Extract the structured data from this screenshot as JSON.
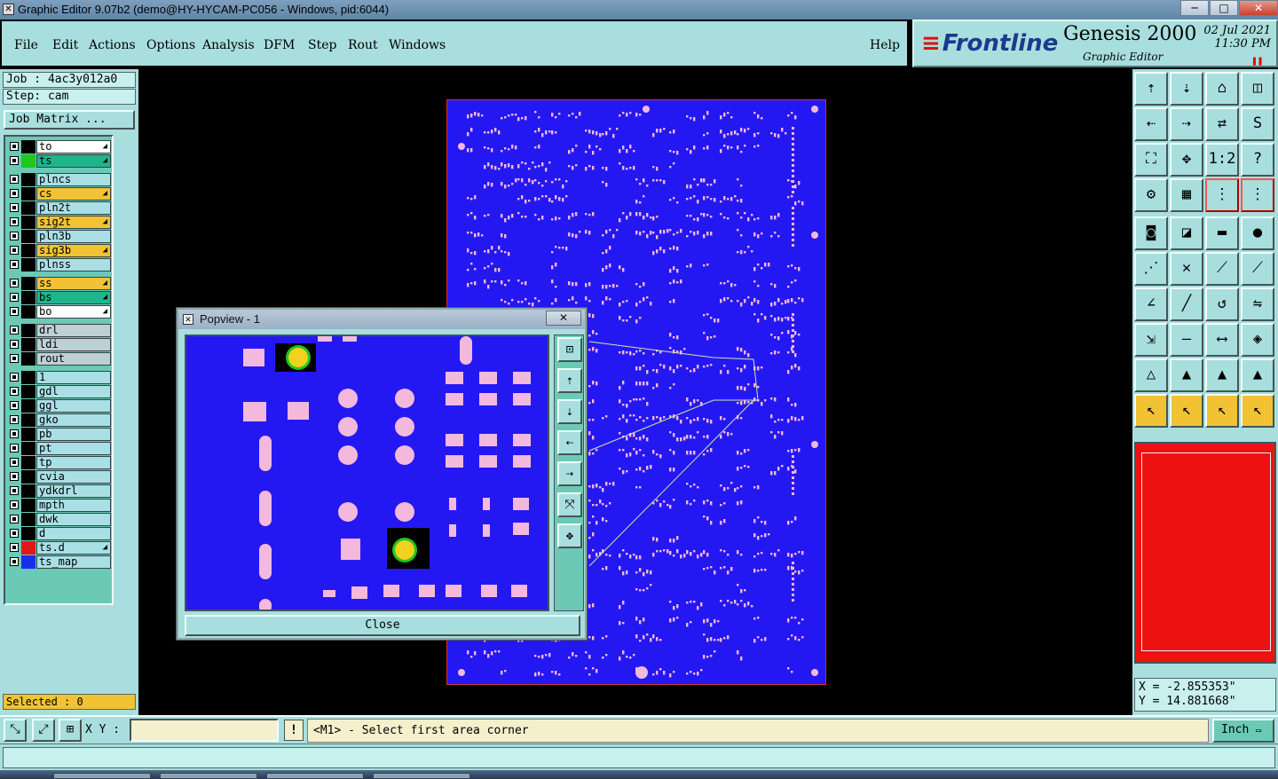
{
  "window": {
    "title": "Graphic Editor 9.07b2 (demo@HY-HYCAM-PC056 - Windows, pid:6044)",
    "buttons": {
      "minimize": "─",
      "maximize": "□",
      "close": "✕"
    }
  },
  "menu": {
    "items": [
      "File",
      "Edit",
      "Actions",
      "Options",
      "Analysis",
      "DFM",
      "Step",
      "Rout",
      "Windows"
    ],
    "help": "Help"
  },
  "brand": {
    "logo": "Frontline",
    "product": "Genesis 2000",
    "subtitle": "Graphic Editor",
    "date": "02 Jul 2021",
    "time": "11:30 PM"
  },
  "job": {
    "job_label": "Job : 4ac3y012a0",
    "step_label": "Step: cam",
    "matrix_button": "Job Matrix ..."
  },
  "layers": [
    {
      "name": "to",
      "color": "#000000",
      "bg": "#ffffff",
      "arrow": "◢"
    },
    {
      "name": "ts",
      "color": "#1ec81e",
      "bg": "#1fb58c",
      "arrow": "◢"
    },
    {
      "name": "plncs",
      "color": "#000000",
      "bg": "#aadfe6",
      "arrow": ""
    },
    {
      "name": "cs",
      "color": "#000000",
      "bg": "#f1c233",
      "arrow": "◢"
    },
    {
      "name": "pln2t",
      "color": "#000000",
      "bg": "#aadfe6",
      "arrow": ""
    },
    {
      "name": "sig2t",
      "color": "#000000",
      "bg": "#f1c233",
      "arrow": "◢"
    },
    {
      "name": "pln3b",
      "color": "#000000",
      "bg": "#aadfe6",
      "arrow": ""
    },
    {
      "name": "sig3b",
      "color": "#000000",
      "bg": "#f1c233",
      "arrow": "◢"
    },
    {
      "name": "plnss",
      "color": "#000000",
      "bg": "#aadfe6",
      "arrow": ""
    },
    {
      "name": "ss",
      "color": "#000000",
      "bg": "#f1c233",
      "arrow": "◢"
    },
    {
      "name": "bs",
      "color": "#000000",
      "bg": "#1fb58c",
      "arrow": "◢"
    },
    {
      "name": "bo",
      "color": "#000000",
      "bg": "#ffffff",
      "arrow": "◢"
    },
    {
      "name": "drl",
      "color": "#000000",
      "bg": "#bfcfd6",
      "arrow": ""
    },
    {
      "name": "ldi",
      "color": "#000000",
      "bg": "#bfcfd6",
      "arrow": ""
    },
    {
      "name": "rout",
      "color": "#000000",
      "bg": "#bfcfd6",
      "arrow": ""
    },
    {
      "name": "1",
      "color": "#000000",
      "bg": "#aadfe6",
      "arrow": ""
    },
    {
      "name": "gdl",
      "color": "#000000",
      "bg": "#aadfe6",
      "arrow": ""
    },
    {
      "name": "ggl",
      "color": "#000000",
      "bg": "#aadfe6",
      "arrow": ""
    },
    {
      "name": "gko",
      "color": "#000000",
      "bg": "#aadfe6",
      "arrow": ""
    },
    {
      "name": "pb",
      "color": "#000000",
      "bg": "#aadfe6",
      "arrow": ""
    },
    {
      "name": "pt",
      "color": "#000000",
      "bg": "#aadfe6",
      "arrow": ""
    },
    {
      "name": "tp",
      "color": "#000000",
      "bg": "#aadfe6",
      "arrow": ""
    },
    {
      "name": "cvia",
      "color": "#000000",
      "bg": "#aadfe6",
      "arrow": ""
    },
    {
      "name": "ydkdrl",
      "color": "#000000",
      "bg": "#aadfe6",
      "arrow": ""
    },
    {
      "name": "mpth",
      "color": "#000000",
      "bg": "#aadfe6",
      "arrow": ""
    },
    {
      "name": "dwk",
      "color": "#000000",
      "bg": "#aadfe6",
      "arrow": ""
    },
    {
      "name": "d",
      "color": "#000000",
      "bg": "#aadfe6",
      "arrow": ""
    },
    {
      "name": "ts.d",
      "color": "#e01818",
      "bg": "#aadfe6",
      "arrow": "◢"
    },
    {
      "name": "ts_map",
      "color": "#1a2ee8",
      "bg": "#aadfe6",
      "arrow": ""
    }
  ],
  "selected": "Selected : 0",
  "popview": {
    "title": "Popview - 1",
    "close_x": "✕",
    "close_button": "Close"
  },
  "coords": {
    "x": "X = -2.855353\"",
    "y": "Y = 14.881668\""
  },
  "bottom": {
    "xy_label": "X Y :",
    "xy_value": "",
    "warn": "!",
    "prompt": "<M1> - Select first area corner",
    "units": "Inch"
  },
  "colors": {
    "panel": "#a9dede",
    "board": "#2418f2",
    "pad": "#f2b9dc",
    "selected_pad": "#f1d21e",
    "highlight": "#f1c233"
  }
}
